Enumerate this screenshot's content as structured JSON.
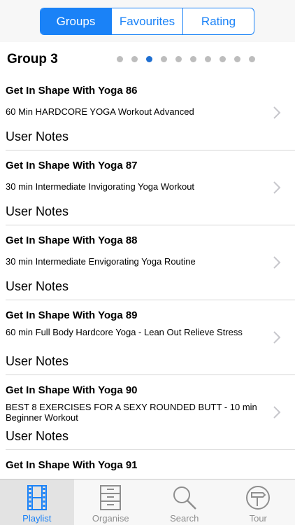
{
  "segments": [
    {
      "label": "Groups",
      "active": true
    },
    {
      "label": "Favourites",
      "active": false
    },
    {
      "label": "Rating",
      "active": false
    }
  ],
  "group": {
    "title": "Group 3",
    "page_count": 10,
    "current_page": 3
  },
  "items": [
    {
      "title": "Get In Shape With Yoga 86",
      "subtitle": "60 Min HARDCORE YOGA Workout Advanced",
      "notes": "User Notes"
    },
    {
      "title": "Get In Shape With Yoga 87",
      "subtitle": "30 min Intermediate Invigorating Yoga Workout",
      "notes": "User Notes"
    },
    {
      "title": "Get In Shape With Yoga 88",
      "subtitle": "30 min Intermediate Envigorating Yoga Routine",
      "notes": "User Notes"
    },
    {
      "title": "Get In Shape With Yoga 89",
      "subtitle": "60 min Full Body Hardcore Yoga - Lean Out  Relieve Stress",
      "notes": "User Notes"
    },
    {
      "title": "Get In Shape With Yoga 90",
      "subtitle": "BEST 8 EXERCISES FOR A SEXY ROUNDED BUTT - 10 min Beginner Workout",
      "notes": "User Notes"
    },
    {
      "title": "Get In Shape With Yoga 91",
      "subtitle": "",
      "notes": ""
    }
  ],
  "tabs": [
    {
      "label": "Playlist",
      "icon": "film-strip-icon",
      "active": true
    },
    {
      "label": "Organise",
      "icon": "cabinet-icon",
      "active": false
    },
    {
      "label": "Search",
      "icon": "magnifier-icon",
      "active": false
    },
    {
      "label": "Tour",
      "icon": "signpost-icon",
      "active": false
    }
  ],
  "colors": {
    "accent": "#1a82f7",
    "dot_active": "#1f6fd1",
    "dot_inactive": "#bdbdbd",
    "tab_inactive": "#8e8e8e"
  }
}
